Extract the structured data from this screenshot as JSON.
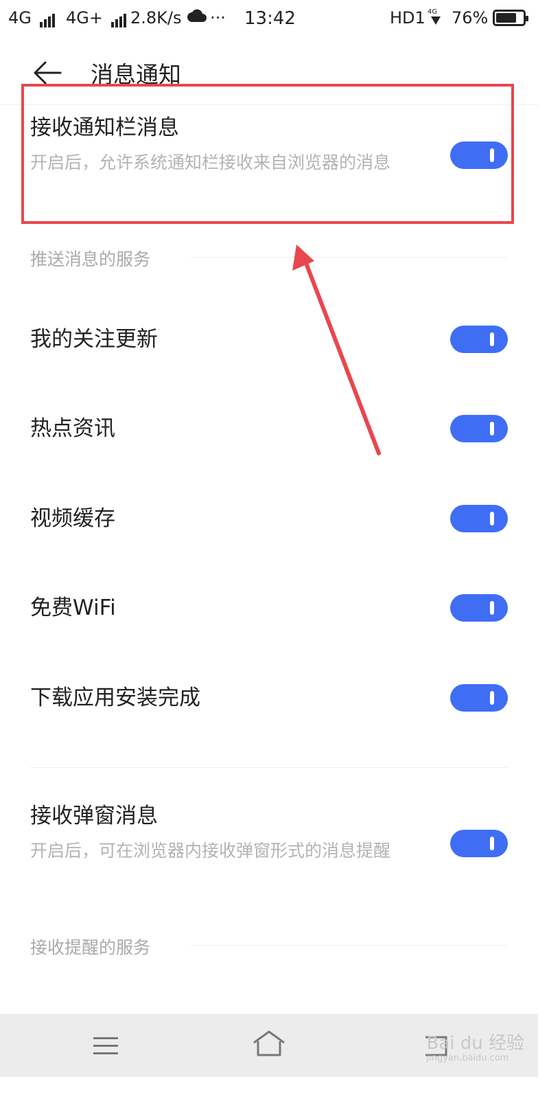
{
  "status_bar": {
    "net1": "4G",
    "net2": "4G+",
    "speed": "2.8K/s",
    "more": "···",
    "time": "13:42",
    "hd": "HD1",
    "battery_text": "76%",
    "battery_level": 0.76
  },
  "header": {
    "title": "消息通知"
  },
  "items": {
    "notify_bar": {
      "label": "接收通知栏消息",
      "desc": "开启后，允许系统通知栏接收来自浏览器的消息",
      "on": true
    },
    "section_push": "推送消息的服务",
    "follow": {
      "label": "我的关注更新",
      "on": true
    },
    "hot": {
      "label": "热点资讯",
      "on": true
    },
    "video": {
      "label": "视频缓存",
      "on": true
    },
    "wifi": {
      "label": "免费WiFi",
      "on": true
    },
    "download": {
      "label": "下载应用安装完成",
      "on": true
    },
    "popup": {
      "label": "接收弹窗消息",
      "desc": "开启后，可在浏览器内接收弹窗形式的消息提醒",
      "on": true
    },
    "section_remind": "接收提醒的服务"
  },
  "watermark": {
    "brand": "Bai du 经验",
    "url": "jingyan.baidu.com"
  },
  "colors": {
    "toggle_on": "#3f6ef5",
    "annotation": "#e8474d"
  },
  "icons": {
    "back": "arrow-left",
    "nav_menu": "hamburger",
    "nav_home": "house-outline",
    "nav_back": "back-square"
  }
}
